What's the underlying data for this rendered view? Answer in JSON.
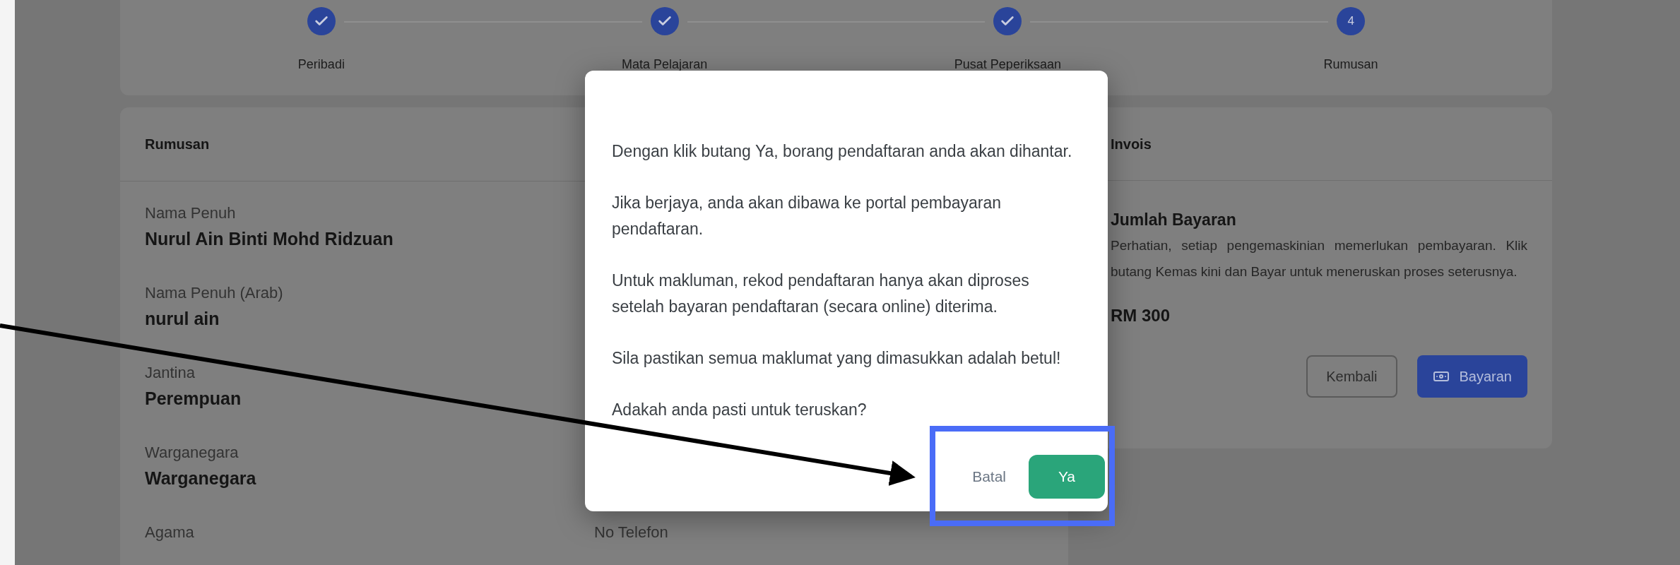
{
  "stepper": [
    {
      "label": "Peribadi",
      "completed": true
    },
    {
      "label": "Mata Pelajaran",
      "completed": true
    },
    {
      "label": "Pusat Peperiksaan",
      "completed": true
    },
    {
      "label": "Rumusan",
      "completed": false,
      "number": "4"
    }
  ],
  "summary_card": {
    "title": "Rumusan",
    "fields": [
      {
        "label": "Nama Penuh",
        "value": "Nurul Ain Binti Mohd Ridzuan"
      },
      {
        "label": "Nama Penuh (Arab)",
        "value": "nurul ain"
      },
      {
        "label": "Jantina",
        "value": "Perempuan"
      },
      {
        "label": "Warganegara",
        "value": "Warganegara"
      },
      {
        "label": "Agama"
      }
    ],
    "column_2_fields": [
      {
        "label": "No Telefon"
      }
    ]
  },
  "invoice_card": {
    "title": "Invois",
    "amount_heading": "Jumlah Bayaran",
    "notice": "Perhatian, setiap pengemaskinian memerlukan pembayaran. Klik butang Kemas kini dan Bayar untuk meneruskan proses seterusnya.",
    "amount": "RM 300",
    "buttons": [
      {
        "label": "Kembali",
        "kind": "outline"
      },
      {
        "label": "Bayaran",
        "kind": "primary"
      }
    ]
  },
  "dialog": {
    "paragraphs": [
      "Dengan klik butang Ya, borang pendaftaran anda akan dihantar.",
      "Jika berjaya, anda akan dibawa ke portal pembayaran pendaftaran.",
      "Untuk makluman, rekod pendaftaran hanya akan diproses setelah bayaran pendaftaran (secara online) diterima.",
      "Sila pastikan semua maklumat yang dimasukkan adalah betul!",
      "Adakah anda pasti untuk teruskan?"
    ],
    "buttons": [
      {
        "label": "Batal",
        "kind": "text"
      },
      {
        "label": "Ya",
        "kind": "primary"
      }
    ]
  }
}
